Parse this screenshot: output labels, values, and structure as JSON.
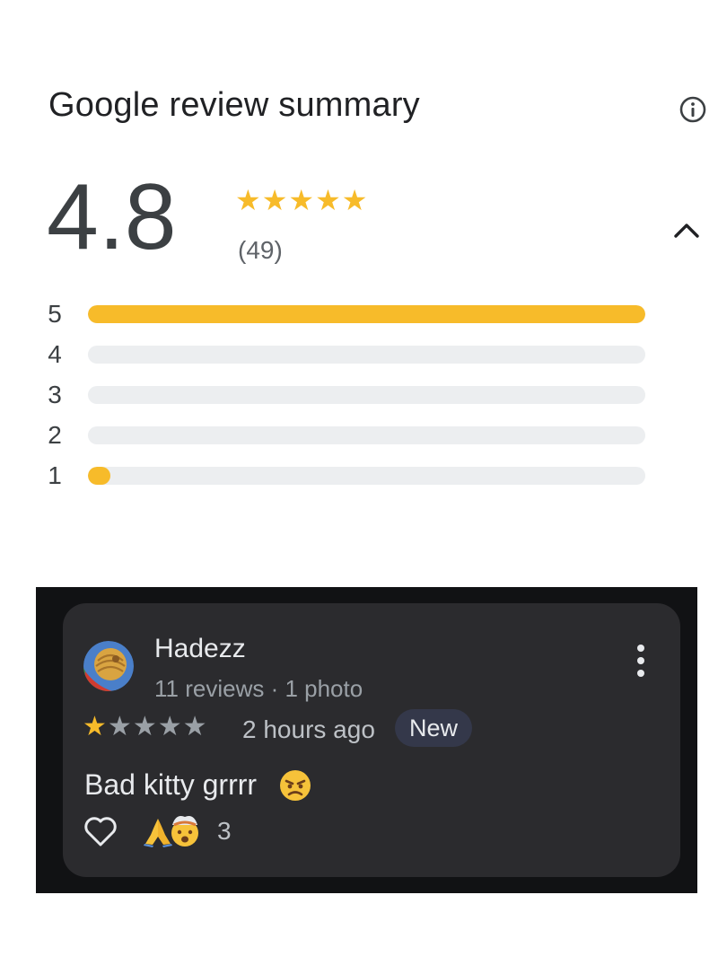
{
  "summary": {
    "title": "Google review summary",
    "info_icon": "info-icon",
    "average_rating": "4.8",
    "stars_filled": 5,
    "review_count": "(49)",
    "collapse_icon": "chevron-up-icon",
    "distribution": [
      {
        "label": "5",
        "fraction": 1.0
      },
      {
        "label": "4",
        "fraction": 0.0
      },
      {
        "label": "3",
        "fraction": 0.0
      },
      {
        "label": "2",
        "fraction": 0.0
      },
      {
        "label": "1",
        "fraction": 0.04
      }
    ]
  },
  "review": {
    "reviewer_name": "Hadezz",
    "reviewer_meta": "11 reviews · 1 photo",
    "rating": 1,
    "time": "2 hours ago",
    "badge": "New",
    "text": "Bad kitty grrrr",
    "text_emoji": "angry-face-emoji",
    "reactions": [
      "folded-hands-emoji",
      "exploding-head-emoji"
    ],
    "reaction_count": "3",
    "like_icon": "heart-outline-icon",
    "more_icon": "more-vertical-icon"
  },
  "colors": {
    "star_gold": "#f7bb2a",
    "star_empty": "#9aa0a6",
    "track": "#eceef0",
    "card_bg": "#2b2b2e"
  }
}
